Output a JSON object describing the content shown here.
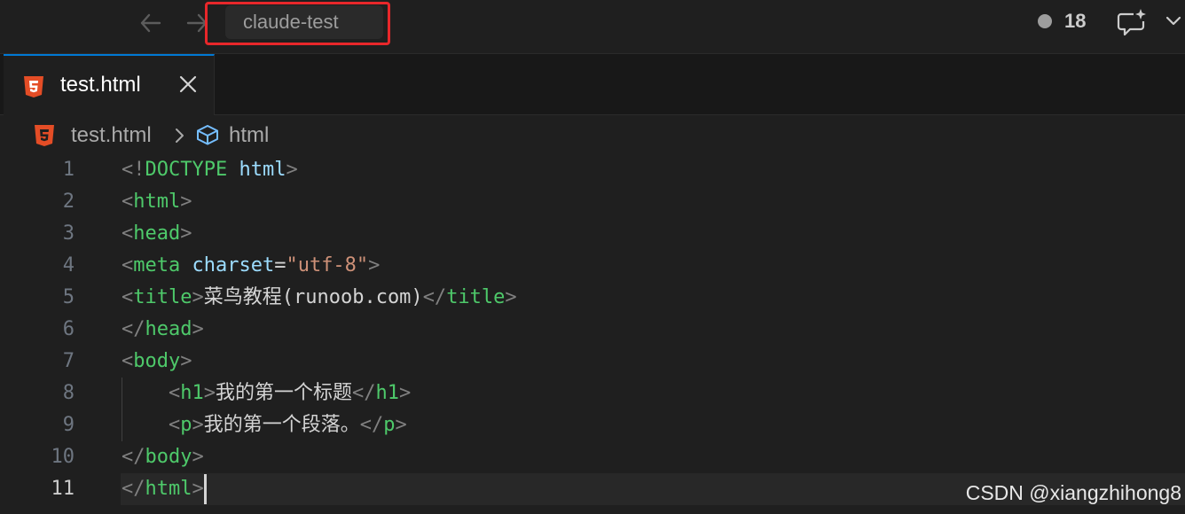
{
  "titlebar": {
    "back_icon": "arrow-left-icon",
    "forward_icon": "arrow-right-icon",
    "search_text": "claude-test",
    "notification_count": "18",
    "chat_icon": "chat-sparkle-icon",
    "chevron_icon": "chevron-down-icon"
  },
  "tab": {
    "label": "test.html",
    "icon": "html5-icon",
    "close_icon": "close-icon",
    "accent": "#0078d4"
  },
  "breadcrumb": {
    "file": "test.html",
    "separator_icon": "chevron-right-icon",
    "symbol_icon": "symbol-cube-icon",
    "symbol": "html"
  },
  "editor": {
    "lines": [
      {
        "num": "1",
        "t1": "<!",
        "t2": "DOCTYPE",
        "t3": " ",
        "t4": "html",
        "t5": ">"
      },
      {
        "num": "2",
        "t1": "<",
        "t2": "html",
        "t3": ">"
      },
      {
        "num": "3",
        "t1": "<",
        "t2": "head",
        "t3": ">"
      },
      {
        "num": "4",
        "t1": "<",
        "t2": "meta",
        "t3": " ",
        "t4": "charset",
        "t5": "=",
        "t6": "\"utf-8\"",
        "t7": ">"
      },
      {
        "num": "5",
        "t1": "<",
        "t2": "title",
        "t3": ">",
        "t4": "菜鸟教程(runoob.com)",
        "t5": "</",
        "t6": "title",
        "t7": ">"
      },
      {
        "num": "6",
        "t1": "</",
        "t2": "head",
        "t3": ">"
      },
      {
        "num": "7",
        "t1": "<",
        "t2": "body",
        "t3": ">"
      },
      {
        "num": "8",
        "t1": "    <",
        "t2": "h1",
        "t3": ">",
        "t4": "我的第一个标题",
        "t5": "</",
        "t6": "h1",
        "t7": ">"
      },
      {
        "num": "9",
        "t1": "    <",
        "t2": "p",
        "t3": ">",
        "t4": "我的第一个段落。",
        "t5": "</",
        "t6": "p",
        "t7": ">"
      },
      {
        "num": "10",
        "t1": "</",
        "t2": "body",
        "t3": ">"
      },
      {
        "num": "11",
        "t1": "</",
        "t2": "html",
        "t3": ">"
      }
    ]
  },
  "watermark": "CSDN @xiangzhihong8",
  "colors": {
    "html5_icon": "#e44d26",
    "highlight_box": "#e8272a",
    "tag": "#4ec96a",
    "attribute": "#9cdcfe",
    "string": "#ce9178",
    "doctype": "#569cd6",
    "bracket": "#808080"
  }
}
